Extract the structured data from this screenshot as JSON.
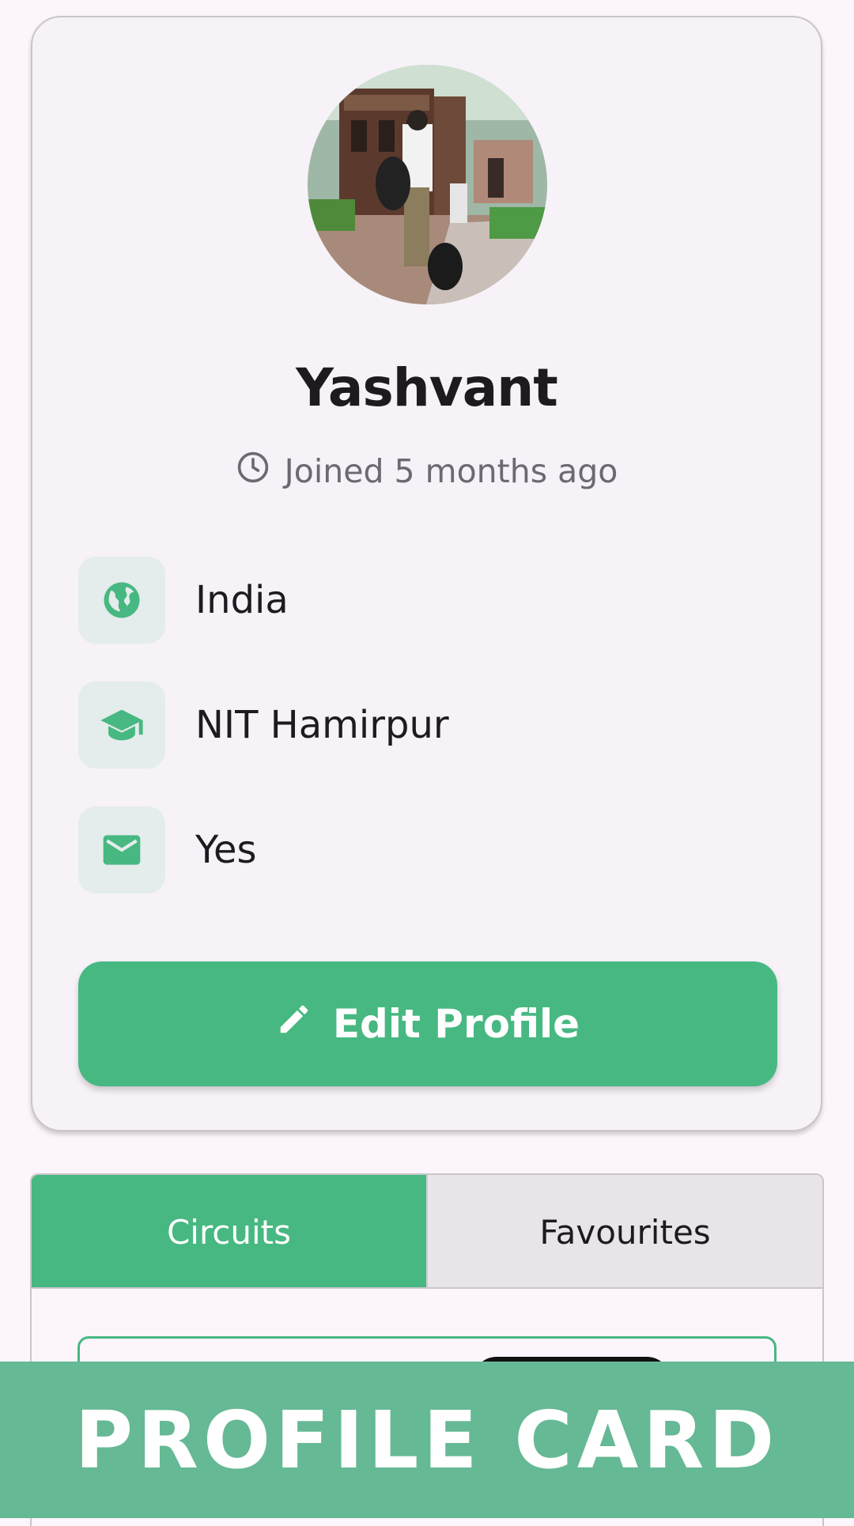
{
  "profile": {
    "name": "Yashvant",
    "joined": "Joined 5 months ago",
    "details": [
      {
        "icon": "globe-icon",
        "text": "India"
      },
      {
        "icon": "graduation-cap-icon",
        "text": "NIT Hamirpur"
      },
      {
        "icon": "mail-icon",
        "text": "Yes"
      }
    ],
    "edit_label": "Edit Profile"
  },
  "tabs": [
    {
      "label": "Circuits",
      "active": true
    },
    {
      "label": "Favourites",
      "active": false
    }
  ],
  "banner": {
    "text": "PROFILE CARD"
  },
  "colors": {
    "accent": "#47b881",
    "banner": "#65b994",
    "background": "#fcf5fb",
    "card": "#f6f2f7"
  }
}
